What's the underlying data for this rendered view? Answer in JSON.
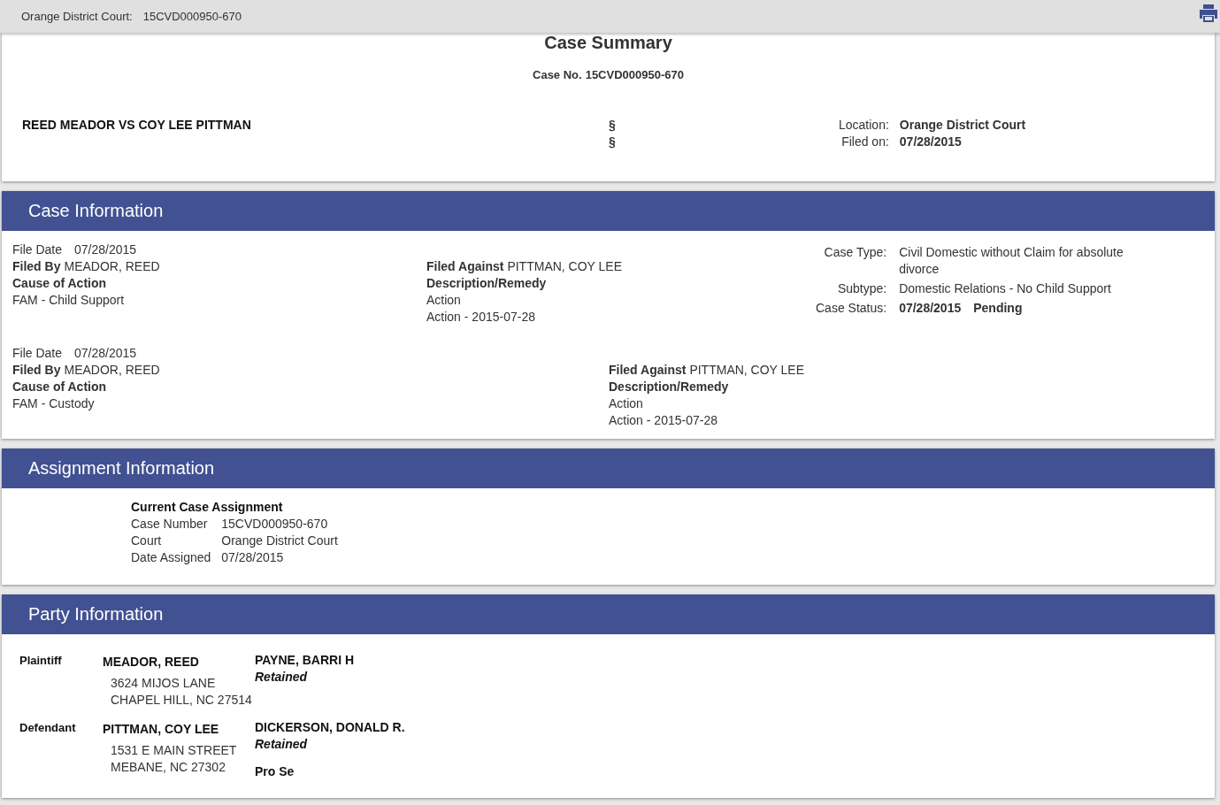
{
  "header": {
    "court_label": "Orange District Court:",
    "case_number": "15CVD000950-670"
  },
  "summary": {
    "title": "Case Summary",
    "case_no_label": "Case No.",
    "case_no": "15CVD000950-670",
    "style": "REED MEADOR VS COY LEE PITTMAN",
    "section_marks": [
      "§",
      "§"
    ],
    "details": [
      {
        "label": "Location:",
        "value": "Orange District Court"
      },
      {
        "label": "Filed on:",
        "value": "07/28/2015"
      }
    ]
  },
  "case_information": {
    "heading": "Case Information",
    "filings": [
      {
        "file_date_label": "File Date",
        "file_date": "07/28/2015",
        "filed_by_label": "Filed By",
        "filed_by": "MEADOR, REED",
        "cause_label": "Cause of Action",
        "cause": "FAM - Child Support",
        "filed_against_label": "Filed Against",
        "filed_against": "PITTMAN, COY LEE",
        "description_label": "Description/Remedy",
        "description_lines": [
          "Action",
          "Action - 2015-07-28"
        ]
      },
      {
        "file_date_label": "File Date",
        "file_date": "07/28/2015",
        "filed_by_label": "Filed By",
        "filed_by": "MEADOR, REED",
        "cause_label": "Cause of Action",
        "cause": "FAM - Custody",
        "filed_against_label": "Filed Against",
        "filed_against": "PITTMAN, COY LEE",
        "description_label": "Description/Remedy",
        "description_lines": [
          "Action",
          "Action - 2015-07-28"
        ]
      }
    ],
    "details": [
      {
        "label": "Case Type:",
        "values": [
          "Civil Domestic without Claim for absolute divorce"
        ]
      },
      {
        "label": "Subtype:",
        "values": [
          "Domestic Relations - No Child Support"
        ]
      },
      {
        "label": "Case Status:",
        "values": [
          "07/28/2015",
          "Pending"
        ],
        "bold": true
      }
    ]
  },
  "assignment_information": {
    "heading": "Assignment Information",
    "subheading": "Current Case Assignment",
    "rows": [
      {
        "label": "Case Number",
        "value": "15CVD000950-670"
      },
      {
        "label": "Court",
        "value": "Orange District Court"
      },
      {
        "label": "Date Assigned",
        "value": "07/28/2015"
      }
    ]
  },
  "party_information": {
    "heading": "Party Information",
    "parties": [
      {
        "role": "Plaintiff",
        "name": "MEADOR, REED",
        "address_lines": [
          "3624 MIJOS LANE",
          "CHAPEL HILL, NC 27514"
        ],
        "attorneys": [
          {
            "name": "PAYNE, BARRI H",
            "status": "Retained"
          }
        ]
      },
      {
        "role": "Defendant",
        "name": "PITTMAN, COY LEE",
        "address_lines": [
          "1531 E MAIN STREET",
          "MEBANE, NC 27302"
        ],
        "attorneys": [
          {
            "name": "DICKERSON, DONALD R.",
            "status": "Retained"
          },
          {
            "name": "Pro Se"
          }
        ]
      }
    ]
  }
}
